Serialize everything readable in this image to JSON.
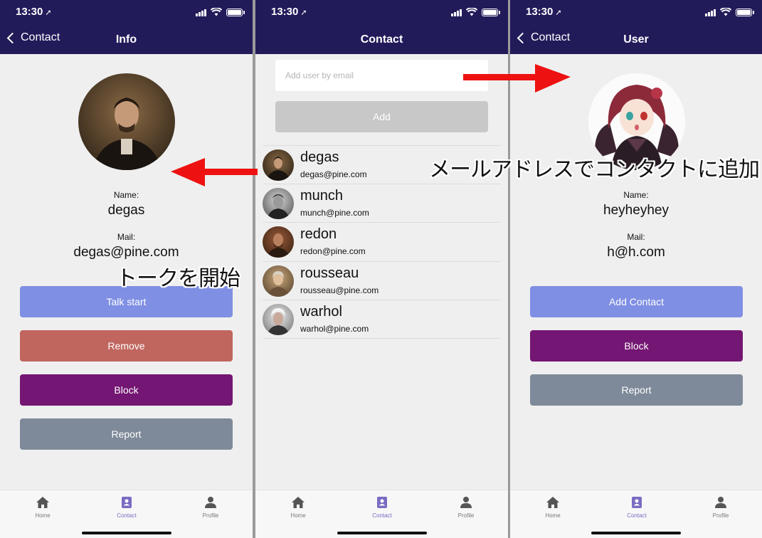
{
  "status_bar": {
    "time": "13:30"
  },
  "screen_info": {
    "back_label": "Contact",
    "title": "Info",
    "name_label": "Name:",
    "name_value": "degas",
    "mail_label": "Mail:",
    "mail_value": "degas@pine.com",
    "buttons": {
      "talk": "Talk start",
      "remove": "Remove",
      "block": "Block",
      "report": "Report"
    }
  },
  "screen_contact": {
    "title": "Contact",
    "email_placeholder": "Add user by email",
    "add_label": "Add",
    "contacts": [
      {
        "name": "degas",
        "email": "degas@pine.com"
      },
      {
        "name": "munch",
        "email": "munch@pine.com"
      },
      {
        "name": "redon",
        "email": "redon@pine.com"
      },
      {
        "name": "rousseau",
        "email": "rousseau@pine.com"
      },
      {
        "name": "warhol",
        "email": "warhol@pine.com"
      }
    ]
  },
  "screen_user": {
    "back_label": "Contact",
    "title": "User",
    "name_label": "Name:",
    "name_value": "heyheyhey",
    "mail_label": "Mail:",
    "mail_value": "h@h.com",
    "buttons": {
      "add_contact": "Add Contact",
      "block": "Block",
      "report": "Report"
    }
  },
  "tab_bar": {
    "home": "Home",
    "contact": "Contact",
    "profile": "Profile",
    "active": "Contact"
  },
  "annotations": {
    "add_by_email": "メールアドレスでコンタクトに追加",
    "start_talk": "トークを開始"
  },
  "colors": {
    "header": "#221b5a",
    "talk_button": "#7f8fe3",
    "add_contact_button": "#7f8fe3",
    "remove_button": "#c0665f",
    "block_button": "#741673",
    "report_button": "#7e8a99",
    "add_button_disabled": "#c8c8c8",
    "arrow": "#ee1111",
    "tab_active": "#7a6bc2"
  }
}
